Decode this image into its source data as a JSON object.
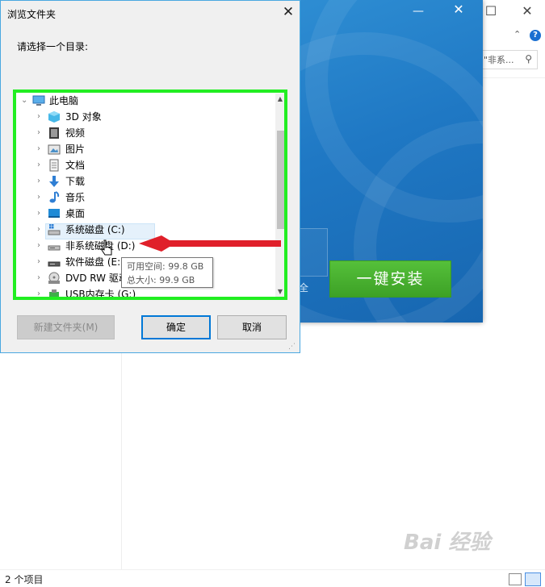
{
  "dialog": {
    "title": "浏览文件夹",
    "prompt": "请选择一个目录:",
    "tree": {
      "root": {
        "label": "此电脑",
        "expanded": true
      },
      "items": [
        {
          "label": "3D 对象",
          "icon": "3d-objects-icon"
        },
        {
          "label": "视频",
          "icon": "video-icon"
        },
        {
          "label": "图片",
          "icon": "pictures-icon"
        },
        {
          "label": "文档",
          "icon": "documents-icon"
        },
        {
          "label": "下载",
          "icon": "download-icon"
        },
        {
          "label": "音乐",
          "icon": "music-icon"
        },
        {
          "label": "桌面",
          "icon": "desktop-icon"
        },
        {
          "label": "系统磁盘 (C:)",
          "icon": "system-drive-icon"
        },
        {
          "label": "非系统磁盘 (D:)",
          "icon": "drive-icon",
          "selected": true
        },
        {
          "label": "软件磁盘 (E:)",
          "icon": "drive-icon"
        },
        {
          "label": "DVD RW 驱动",
          "icon": "dvd-drive-icon"
        },
        {
          "label": "USB内存卡 (G:)",
          "icon": "usb-drive-icon"
        }
      ]
    },
    "tooltip": {
      "free": "可用空间: 99.8 GB",
      "total": "总大小: 99.9 GB"
    },
    "buttons": {
      "new_folder": "新建文件夹(M)",
      "ok": "确定",
      "cancel": "取消"
    },
    "highlight_color": "#22ee22"
  },
  "installer": {
    "install_label": "一键安装",
    "partial_text": "全",
    "accent": "#3da126",
    "bg": "#1f78c4"
  },
  "explorer": {
    "search_placeholder": "\"非系...",
    "status": "2 个项目"
  },
  "watermark": "Bai 经验",
  "annotation": {
    "arrow_color": "#e0202a"
  }
}
